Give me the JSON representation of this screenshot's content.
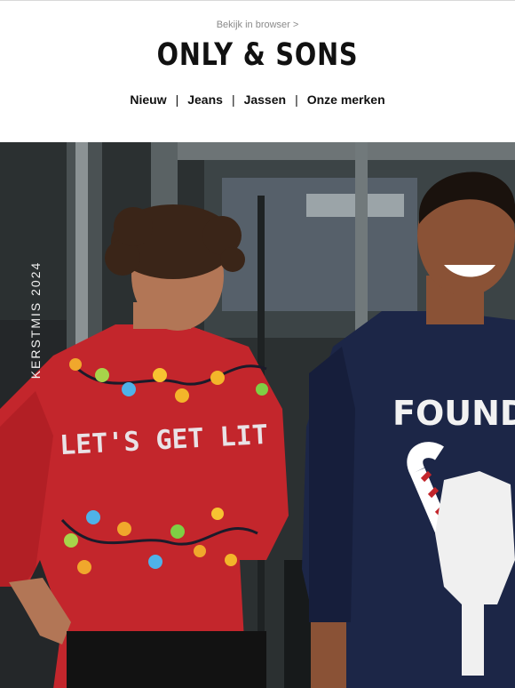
{
  "header": {
    "browser_link": "Bekijk in browser >",
    "logo_text": "ONLY & SONS"
  },
  "nav": {
    "items": [
      {
        "label": "Nieuw"
      },
      {
        "label": "Jeans"
      },
      {
        "label": "Jassen"
      },
      {
        "label": "Onze merken"
      }
    ],
    "separator": "|"
  },
  "hero": {
    "vertical_label": "KERSTMIS 2024",
    "left_sweater_text": "LET'S GET LIT",
    "right_sweater_text": "FOUND",
    "colors": {
      "background": "#2a2e2f",
      "red_sweater": "#c3262c",
      "navy_sweater": "#1c2647",
      "skin": "#b27656"
    }
  }
}
